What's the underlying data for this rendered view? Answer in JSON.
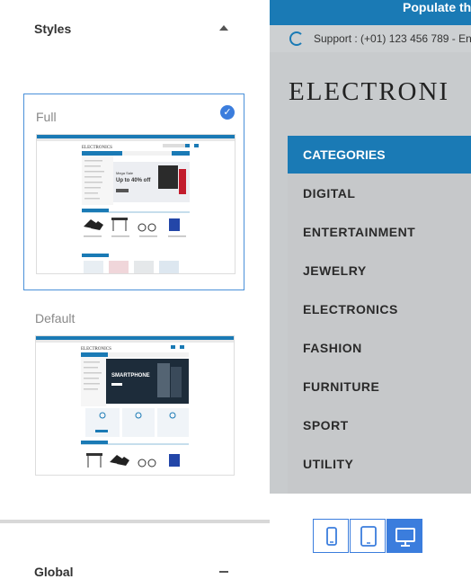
{
  "styles_panel": {
    "title": "Styles",
    "options": [
      {
        "label": "Full",
        "selected": true
      },
      {
        "label": "Default",
        "selected": false
      }
    ],
    "next_section_title": "Global"
  },
  "thumbnails": {
    "brand": "ELECTRONICS",
    "full_banner": "Up to 40% off",
    "default_banner": "SMARTPHONE"
  },
  "preview": {
    "topbar_text": "Populate th",
    "support_text": "Support : (+01) 123 456 789 - En",
    "brand": "ELECTRONI",
    "categories_title": "CATEGORIES",
    "categories": [
      "DIGITAL",
      "ENTERTAINMENT",
      "JEWELRY",
      "ELECTRONICS",
      "FASHION",
      "FURNITURE",
      "SPORT",
      "UTILITY"
    ]
  },
  "devices": [
    {
      "name": "mobile",
      "active": false
    },
    {
      "name": "tablet",
      "active": false
    },
    {
      "name": "desktop",
      "active": true
    }
  ],
  "colors": {
    "accent": "#1a7ab5",
    "selected": "#3b7ddd"
  }
}
